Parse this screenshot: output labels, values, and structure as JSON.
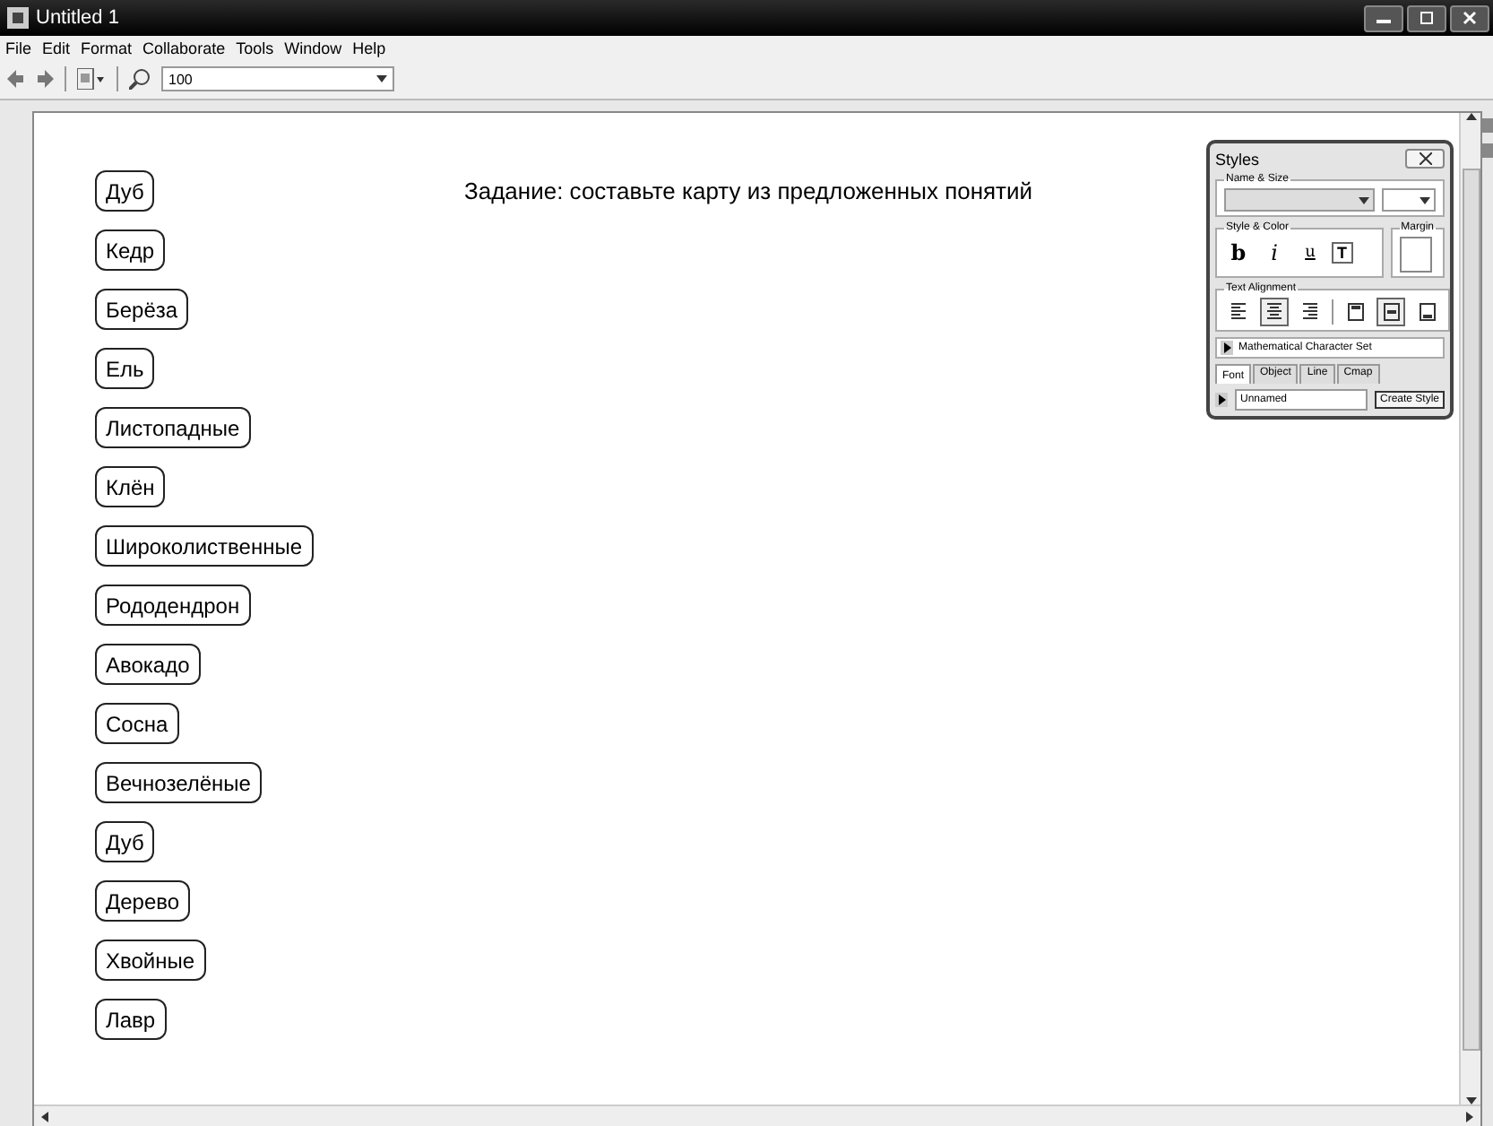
{
  "window": {
    "title": "Untitled 1"
  },
  "menu": [
    "File",
    "Edit",
    "Format",
    "Collaborate",
    "Tools",
    "Window",
    "Help"
  ],
  "toolbar": {
    "zoom": "100"
  },
  "task": "Задание: составьте карту из предложенных понятий",
  "concepts": [
    "Дуб",
    "Кедр",
    "Берёза",
    "Ель",
    "Листопадные",
    "Клён",
    "Широколиственные",
    "Рододендрон",
    "Авокадо",
    "Сосна",
    "Вечнозелёные",
    "Дуб",
    "Дерево",
    "Хвойные",
    "Лавр"
  ],
  "styles": {
    "title": "Styles",
    "name_size": "Name & Size",
    "style_color": "Style & Color",
    "margin": "Margin",
    "style_buttons": [
      {
        "label": "b",
        "kind": "bold"
      },
      {
        "label": "i",
        "kind": "italic"
      },
      {
        "label": "u",
        "kind": "underline"
      }
    ],
    "text_color": "T",
    "text_alignment": "Text Alignment",
    "h_align": [
      {
        "selected": false
      },
      {
        "selected": true
      },
      {
        "selected": false
      }
    ],
    "v_align": [
      {
        "selected": false
      },
      {
        "selected": true
      },
      {
        "selected": false
      }
    ],
    "char_set": "Mathematical Character Set",
    "tabs": [
      {
        "label": "Font",
        "selected": true
      },
      {
        "label": "Object",
        "selected": false
      },
      {
        "label": "Line",
        "selected": false
      },
      {
        "label": "Cmap",
        "selected": false
      }
    ],
    "style_name": "Unnamed",
    "create_button": "Create Style"
  }
}
